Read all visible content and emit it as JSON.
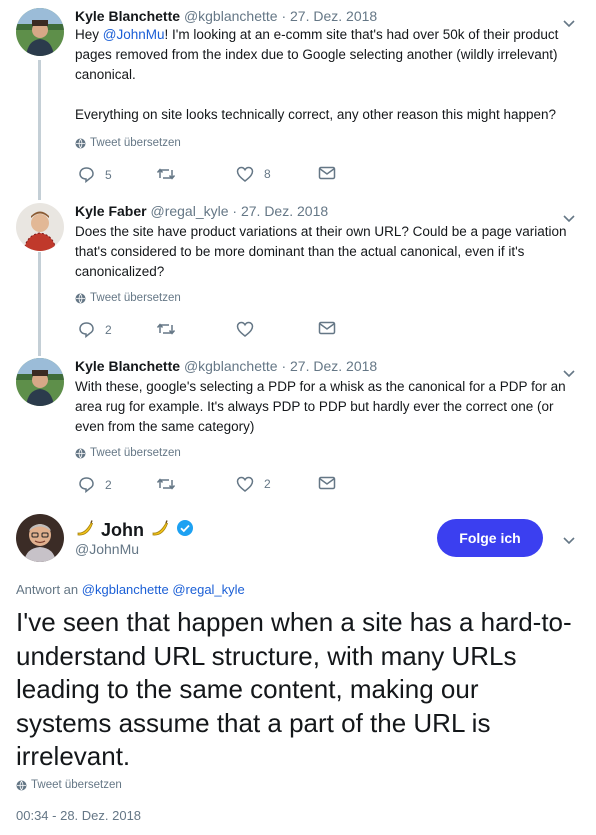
{
  "tweets": [
    {
      "name": "Kyle Blanchette",
      "handle": "@kgblanchette",
      "date": "27. Dez. 2018",
      "text_before": "Hey ",
      "mention": "@JohnMu",
      "text_after": "! I'm looking at an e-comm site that's had over 50k of their product pages removed from the index due to Google selecting another (wildly irrelevant) canonical.",
      "text2": "Everything on site looks technically correct, any other reason this might happen?",
      "translate": "Tweet übersetzen",
      "replies": "5",
      "retweets": "",
      "likes": "8"
    },
    {
      "name": "Kyle Faber",
      "handle": "@regal_kyle",
      "date": "27. Dez. 2018",
      "text": "Does the site have product variations at their own URL? Could be a page variation that's considered to be more dominant than the actual canonical, even if it's canonicalized?",
      "translate": "Tweet übersetzen",
      "replies": "2",
      "retweets": "",
      "likes": ""
    },
    {
      "name": "Kyle Blanchette",
      "handle": "@kgblanchette",
      "date": "27. Dez. 2018",
      "text": "With these, google's selecting a PDP for a whisk as the canonical for a PDP for an area rug for example. It's always PDP to PDP but hardly ever the correct one (or even from the same category)",
      "translate": "Tweet übersetzen",
      "replies": "2",
      "retweets": "",
      "likes": "2"
    }
  ],
  "main": {
    "name": "John",
    "handle": "@JohnMu",
    "follow_label": "Folge ich",
    "reply_prefix": "Antwort an",
    "reply_to_1": "@kgblanchette",
    "reply_to_2": "@regal_kyle",
    "text": "I've seen that happen when a site has a hard-to-understand URL structure, with many URLs leading to the same content, making our systems assume that a part of the URL is irrelevant.",
    "translate": "Tweet übersetzen",
    "timestamp": "00:34 - 28. Dez. 2018"
  },
  "colors": {
    "accent": "#1b5fd6",
    "follow_button": "#3b3ff0",
    "verified": "#1da1f2",
    "muted": "#657786"
  },
  "icons": [
    "chevron-down-icon",
    "reply-icon",
    "retweet-icon",
    "like-icon",
    "dm-icon",
    "globe-icon",
    "banana-icon",
    "verified-icon"
  ]
}
